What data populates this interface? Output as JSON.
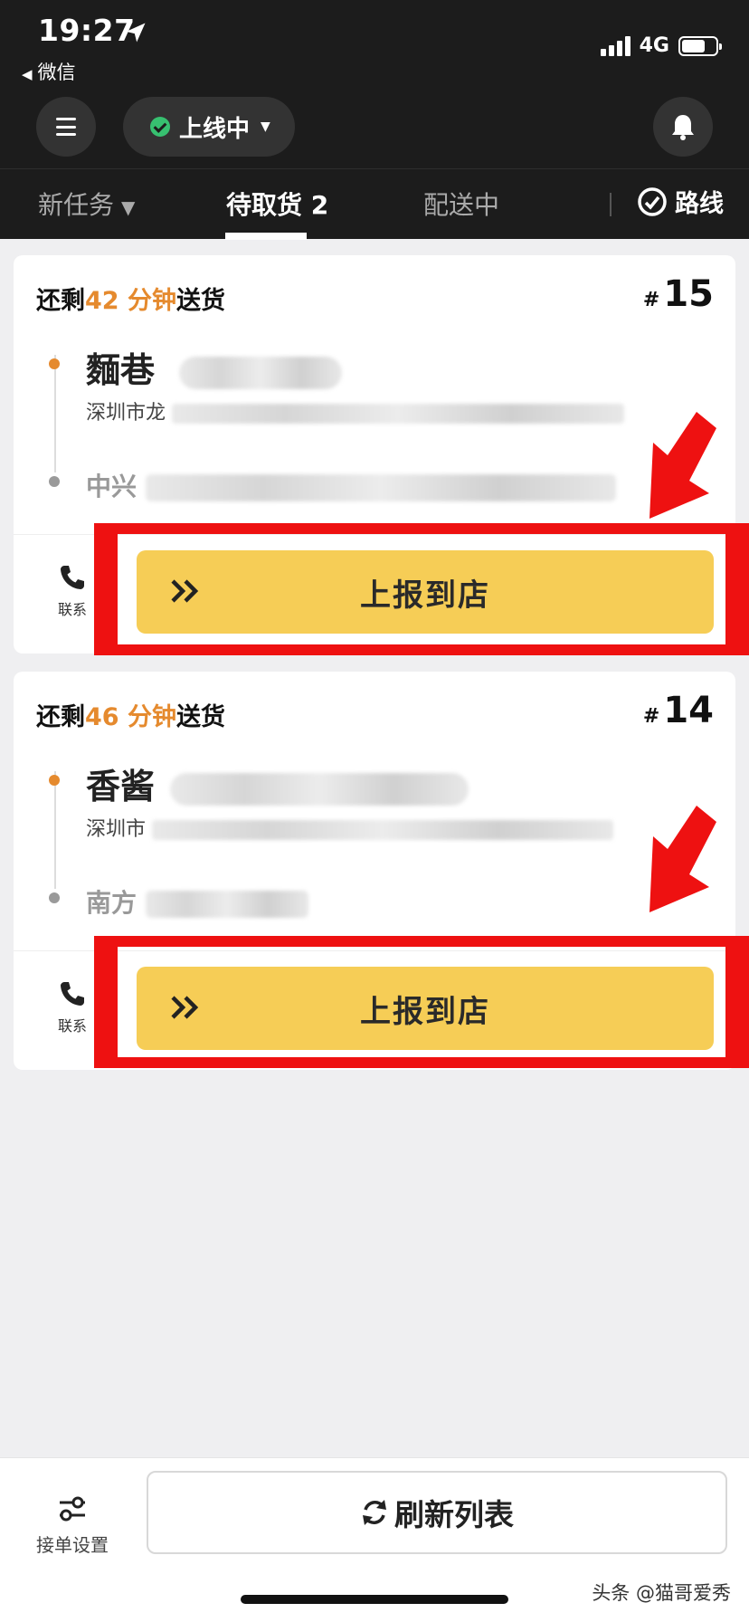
{
  "status": {
    "time": "19:27",
    "back_app": "微信",
    "network": "4G"
  },
  "header": {
    "online_label": "上线中"
  },
  "tabs": {
    "new_tasks": "新任务",
    "pickup": "待取货 2",
    "delivering": "配送中",
    "route": "路线"
  },
  "orders": [
    {
      "time_prefix": "还剩",
      "minutes": "42 分钟",
      "time_suffix": "送货",
      "hash": "#",
      "number": "15",
      "store": "麵巷",
      "address": "深圳市龙",
      "destination": "中兴",
      "contact_label": "联系",
      "action_label": "上报到店"
    },
    {
      "time_prefix": "还剩",
      "minutes": "46 分钟",
      "time_suffix": "送货",
      "hash": "#",
      "number": "14",
      "store": "香酱",
      "address": "深圳市",
      "destination": "南方",
      "contact_label": "联系",
      "action_label": "上报到店"
    }
  ],
  "footer": {
    "settings_label": "接单设置",
    "refresh_label": "刷新列表"
  },
  "watermark": "头条 @猫哥爱秀",
  "colors": {
    "accent_yellow": "#f6cd56",
    "accent_orange": "#e58a2e",
    "online_green": "#37c070",
    "annotation_red": "#ee1111"
  }
}
